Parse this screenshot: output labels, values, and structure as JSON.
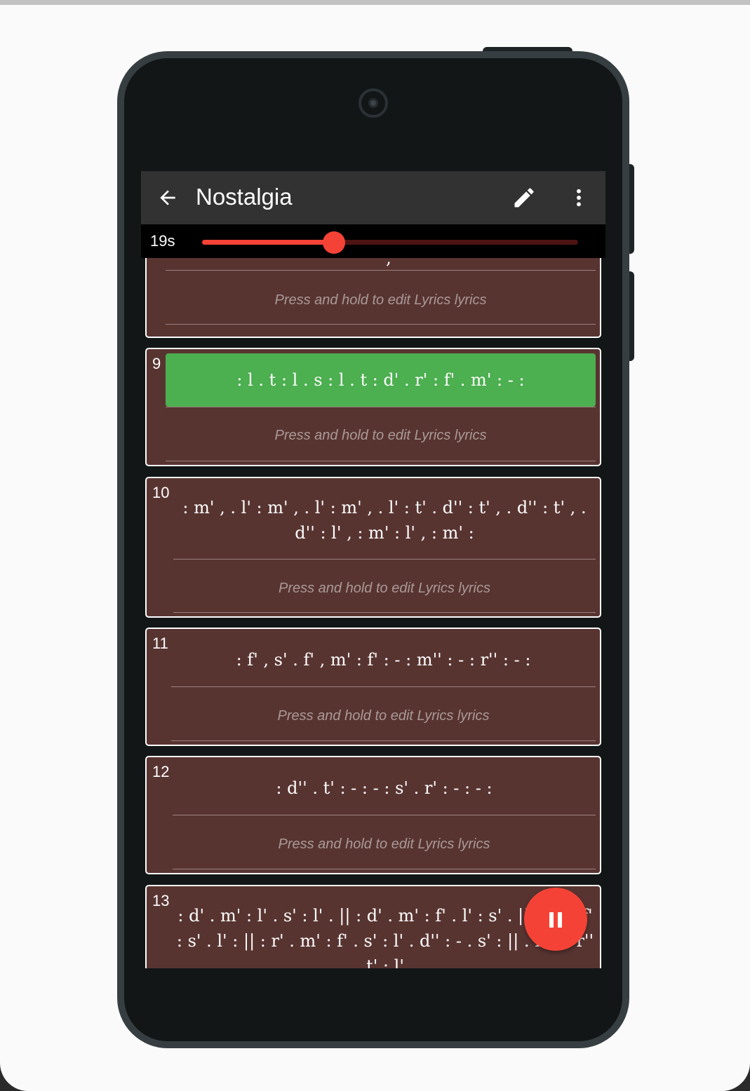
{
  "app": {
    "title": "Nostalgia"
  },
  "toolbar": {
    "back_icon": "arrow-left-icon",
    "edit_icon": "pencil-icon",
    "more_icon": "more-vertical-icon"
  },
  "player": {
    "elapsed": "19s",
    "progress": 0.35,
    "button_icon": "pause-icon"
  },
  "colors": {
    "accent": "#f44336",
    "card_bg": "#583431",
    "active_line": "#4caf50",
    "appbar": "#323232"
  },
  "lines": [
    {
      "number": "",
      "notes": ",",
      "lyrics": "Press and hold to edit Lyrics lyrics"
    },
    {
      "number": "9",
      "notes": ": l . t : l . s : l . t : d' . r' : f' . m' : - :",
      "lyrics": "Press and hold to edit Lyrics lyrics",
      "active": true
    },
    {
      "number": "10",
      "notes": ": m' , . l' : m' , . l' : m' , . l' : t' . d'' : t' , . d'' : t' , . d'' : l' , : m' : l' , : m' :",
      "lyrics": "Press and hold to edit Lyrics lyrics"
    },
    {
      "number": "11",
      "notes": ": f' , s' . f' , m' : f' : - : m'' : - : r'' : - :",
      "lyrics": "Press and hold to edit Lyrics lyrics"
    },
    {
      "number": "12",
      "notes": ": d'' . t' : - : - : s' . r' : - : - :",
      "lyrics": "Press and hold to edit Lyrics lyrics"
    },
    {
      "number": "13",
      "notes": ": d' . m' : l' . s' : l' . || : d' . m' : f' . l' : s' . || . d'' : f' : s' . l' : || : r' . m' : f' . s' : l' . d'' : - . s' : || . m'' : r'' t' : l'",
      "lyrics": ""
    }
  ]
}
